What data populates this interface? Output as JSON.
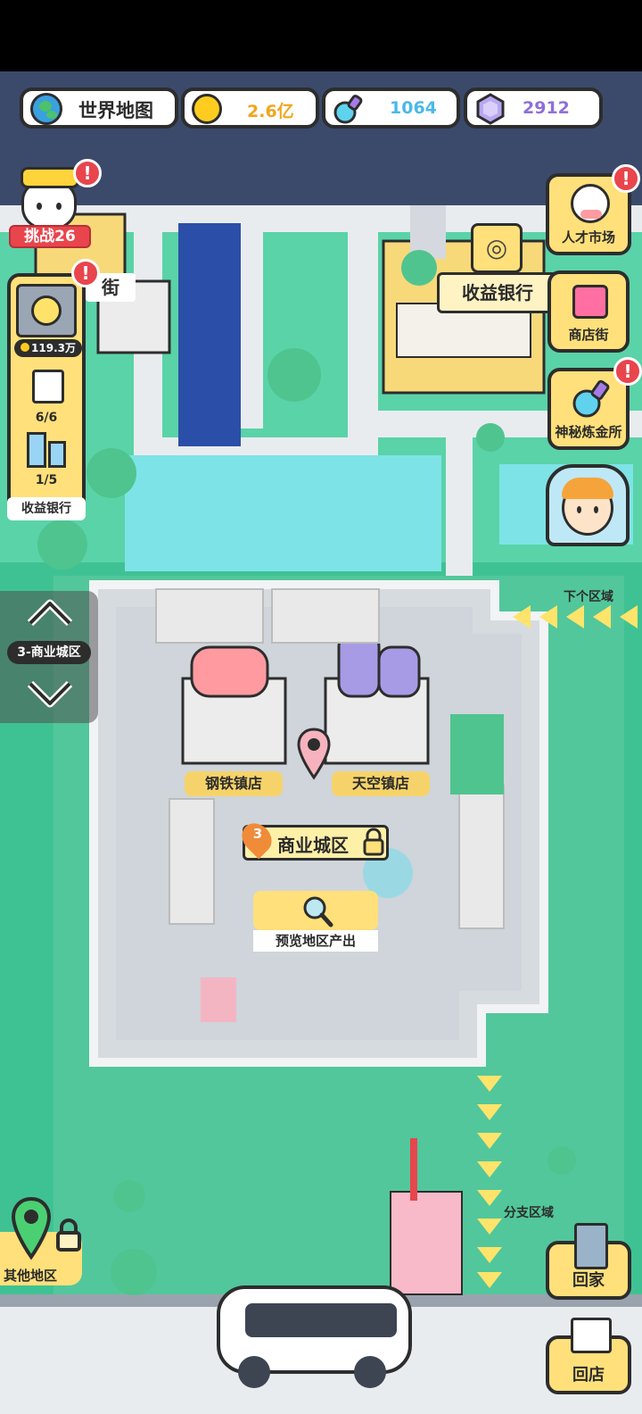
{
  "topbar": {
    "world_map_label": "世界地图",
    "gold_value": "2.6亿",
    "potion_value": "1064",
    "gem_value": "2912"
  },
  "left_panel": {
    "challenge_label": "挑战26",
    "vault_amount": "119.3万",
    "printer_count": "6/6",
    "building_count": "1/5",
    "panel_title": "收益银行",
    "street_fragment": "街"
  },
  "right_panel": {
    "talent_market": "人才市场",
    "shop_street": "商店街",
    "alchemy": "神秘炼金所"
  },
  "map": {
    "bank_sign": "收益银行",
    "district_label": "3-商业城区",
    "next_region": "下个区域",
    "steel_shop": "钢铁镇店",
    "sky_shop": "天空镇店",
    "district_badge_num": "3",
    "district_name": "商业城区",
    "preview_label": "预览地区产出",
    "branch_region": "分支区域",
    "other_regions": "其他地区"
  },
  "bottom": {
    "go_home": "回家",
    "go_shop": "回店"
  },
  "alert_mark": "!",
  "colors": {
    "accent_yellow": "#ffe07a",
    "alert_red": "#e8454d",
    "gold_text": "#f2a51c",
    "potion_text": "#4bb8e8",
    "gem_text": "#8f6fd8",
    "map_green": "#3fc293"
  }
}
